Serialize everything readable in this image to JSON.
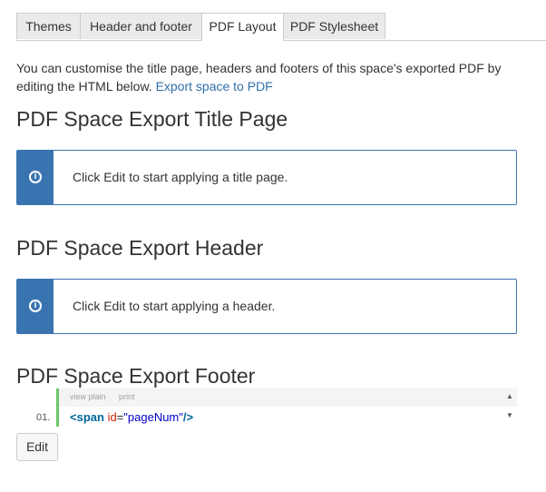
{
  "tabs": [
    {
      "label": "Themes"
    },
    {
      "label": "Header and footer"
    },
    {
      "label": "PDF Layout"
    },
    {
      "label": "PDF Stylesheet"
    }
  ],
  "active_tab": "PDF Layout",
  "intro": {
    "text": "You can customise the title page, headers and footers of this space's exported PDF by editing the HTML below. ",
    "link": "Export space to PDF"
  },
  "sections": {
    "title_page": {
      "heading": "PDF Space Export Title Page",
      "message": "Click Edit to start applying a title page."
    },
    "header": {
      "heading": "PDF Space Export Header",
      "message": "Click Edit to start applying a header."
    },
    "footer": {
      "heading": "PDF Space Export Footer"
    }
  },
  "code_viewer": {
    "view_plain": "view plain",
    "print": "print",
    "line_number": "01.",
    "tokens": {
      "open": "<",
      "tag": "span",
      "attr": "id",
      "eq": "=",
      "value": "\"pageNum\"",
      "close": "/>"
    }
  },
  "edit_button": "Edit",
  "icons": {
    "info": "info-icon",
    "scroll_up": "triangle-up-icon",
    "scroll_down": "triangle-down-icon"
  },
  "colors": {
    "accent": "#3a74b0",
    "link": "#2f6faa",
    "gutter": "#6cc66c"
  }
}
